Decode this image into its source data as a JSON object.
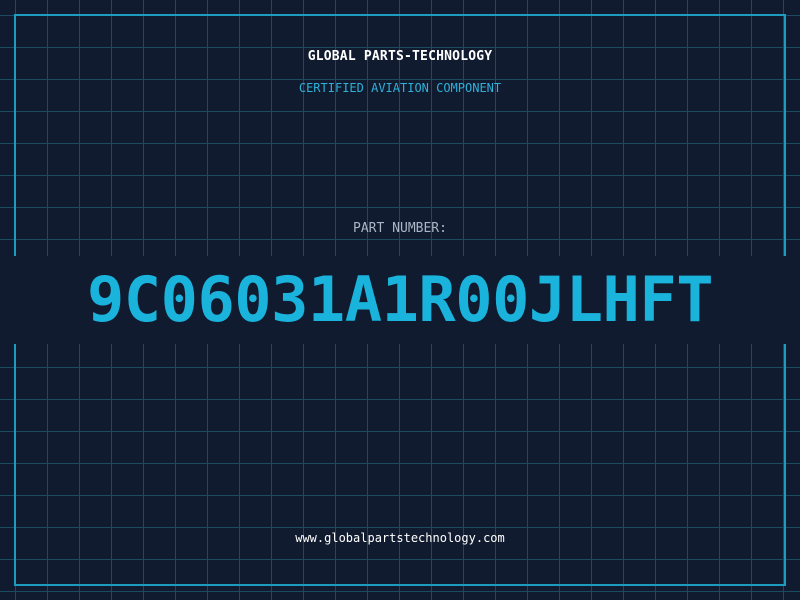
{
  "header": {
    "brand": "GLOBAL PARTS-TECHNOLOGY",
    "tagline": "CERTIFIED AVIATION COMPONENT"
  },
  "part": {
    "label": "PART NUMBER:",
    "number": "9C06031A1R00JLHFT"
  },
  "footer": {
    "website": "www.globalpartstechnology.com"
  },
  "colors": {
    "background": "#111b30",
    "grid": "#1c4a5e",
    "frame": "#1d9cc0",
    "accent": "#1ab3dc",
    "tagline": "#2fb0d8",
    "label": "#a9b6c6",
    "text": "#ffffff"
  }
}
